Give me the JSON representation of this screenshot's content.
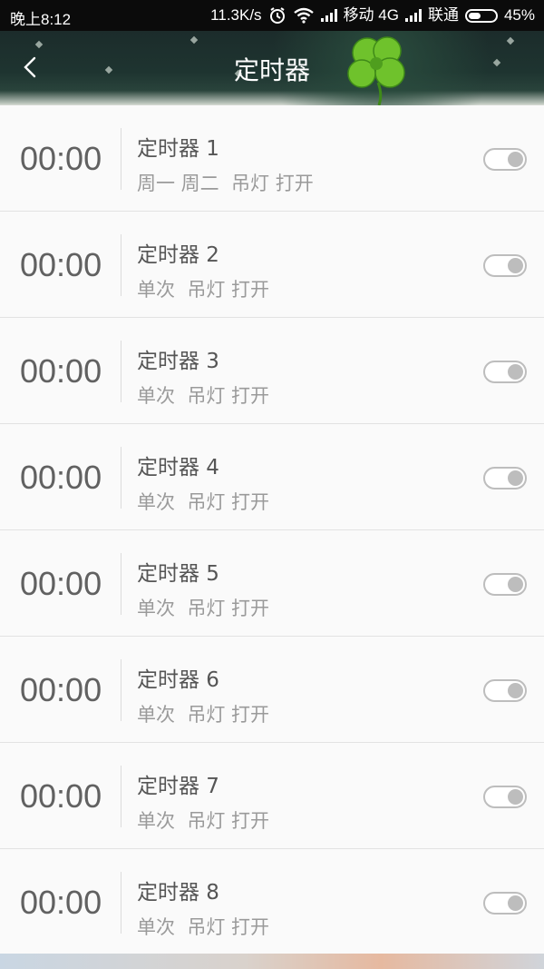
{
  "status_bar": {
    "time": "晚上8:12",
    "speed": "11.3K/s",
    "carrier1": "移动 4G",
    "carrier2": "联通",
    "battery": "45%",
    "battery_level": 0.45
  },
  "header": {
    "title": "定时器",
    "back_icon": "chevron-left-icon",
    "decoration": "four-leaf-clover"
  },
  "colors": {
    "header_bg": "#1e3430",
    "row_bg": "#fafafa",
    "time_text": "#616161",
    "toggle_off": "#bdbdbd"
  },
  "timers": [
    {
      "time": "00:00",
      "name": "定时器 1",
      "desc": "周一 周二  吊灯 打开",
      "enabled": false
    },
    {
      "time": "00:00",
      "name": "定时器 2",
      "desc": "单次  吊灯 打开",
      "enabled": false
    },
    {
      "time": "00:00",
      "name": "定时器 3",
      "desc": "单次  吊灯 打开",
      "enabled": false
    },
    {
      "time": "00:00",
      "name": "定时器 4",
      "desc": "单次  吊灯 打开",
      "enabled": false
    },
    {
      "time": "00:00",
      "name": "定时器 5",
      "desc": "单次  吊灯 打开",
      "enabled": false
    },
    {
      "time": "00:00",
      "name": "定时器 6",
      "desc": "单次  吊灯 打开",
      "enabled": false
    },
    {
      "time": "00:00",
      "name": "定时器 7",
      "desc": "单次  吊灯 打开",
      "enabled": false
    },
    {
      "time": "00:00",
      "name": "定时器 8",
      "desc": "单次  吊灯 打开",
      "enabled": false
    }
  ]
}
